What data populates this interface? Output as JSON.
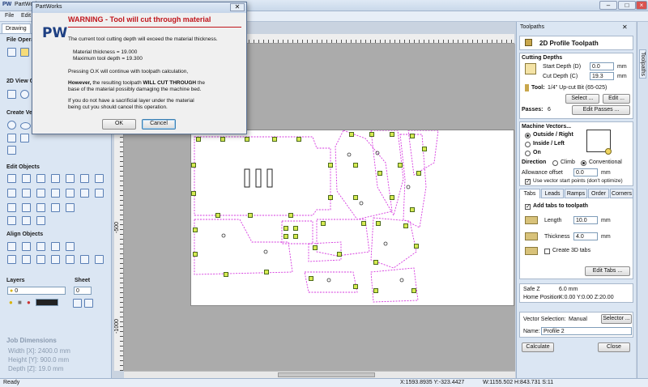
{
  "window": {
    "logo": "PW",
    "title": "PartWorks",
    "menu": [
      "File",
      "Edit"
    ]
  },
  "left_panel": {
    "tab": "Drawing",
    "sections": {
      "file": "File Opera",
      "view": "2D View C",
      "create": "Create Vect",
      "edit": "Edit Objects",
      "align": "Align Objects",
      "layers": "Layers",
      "sheet": "Sheet"
    },
    "layer_value": "0",
    "sheet_value": "0",
    "job": {
      "title": "Job Dimensions",
      "width": "Width  [X]: 2400.0 mm",
      "height": "Height [Y]: 900.0 mm",
      "depth": "Depth  [Z]: 19.0 mm"
    }
  },
  "rulers": {
    "left_marks": [
      "-500",
      "-1000"
    ]
  },
  "dialog": {
    "title": "PartWorks",
    "logo": "PW",
    "heading": "WARNING - Tool will cut through material",
    "line1": "The current tool cutting depth will exceed the material thickness.",
    "thickness": "Material thickness = 19.000",
    "max_depth": "Maximum tool depth = 19.300",
    "line2": "Pressing O.K will continue with toolpath calculation,",
    "line3_bold": "However,",
    "line3a": " the resulting toolpath ",
    "line3b_bold": "WILL CUT THROUGH",
    "line3c": " the",
    "line4": "base of the material possibly damaging the machine bed.",
    "line5": "If you do not have a sacrificial layer under the material",
    "line6": "being cut you should cancel this operation.",
    "ok": "OK",
    "cancel": "Cancel"
  },
  "right_panel": {
    "header": "Toolpaths",
    "sidetab": "Toolpaths",
    "tool_title": "2D Profile Toolpath",
    "cutting_depths": "Cutting Depths",
    "start_depth_label": "Start Depth (D)",
    "start_depth": "0.0",
    "cut_depth_label": "Cut Depth (C)",
    "cut_depth": "19.3",
    "unit": "mm",
    "tool_label": "Tool:",
    "tool_name": "1/4\" Up-cut Bit (65-025)",
    "select_btn": "Select ...",
    "edit_btn": "Edit ...",
    "passes_label": "Passes:",
    "passes": "6",
    "edit_passes_btn": "Edit Passes ...",
    "machine_vectors": "Machine Vectors...",
    "outside_right": "Outside / Right",
    "inside_left": "Inside / Left",
    "on": "On",
    "direction": "Direction",
    "climb": "Climb",
    "conventional": "Conventional",
    "allowance_label": "Allowance offset",
    "allowance": "0.0",
    "use_vector_start": "Use vector start points (don't optimize)",
    "tabs": [
      "Tabs",
      "Leads",
      "Ramps",
      "Order",
      "Corners"
    ],
    "add_tabs": "Add tabs to toolpath",
    "length_label": "Length",
    "length": "10.0",
    "thickness_label": "Thickness",
    "thickness": "4.0",
    "create_3d_tabs": "Create 3D tabs",
    "edit_tabs_btn": "Edit Tabs ...",
    "safe_z_label": "Safe Z",
    "safe_z": "6.0 mm",
    "home_label": "Home Position",
    "home": "X:0.00 Y:0.00 Z:20.00",
    "vector_selection_label": "Vector Selection:",
    "vector_selection": "Manual",
    "selector_btn": "Selector ...",
    "name_label": "Name:",
    "name": "Profile 2",
    "calculate_btn": "Calculate",
    "close_btn": "Close"
  },
  "status": {
    "text": "Ready",
    "coords": "X:1593.8935 Y:-323.4427",
    "size": "W:1155.502   H:843.731  S:11"
  },
  "colors": {
    "warning": "#c0151b",
    "accent": "#1d3f82",
    "toolpath": "#d63adf",
    "tab_marker": "#d6ea52"
  }
}
